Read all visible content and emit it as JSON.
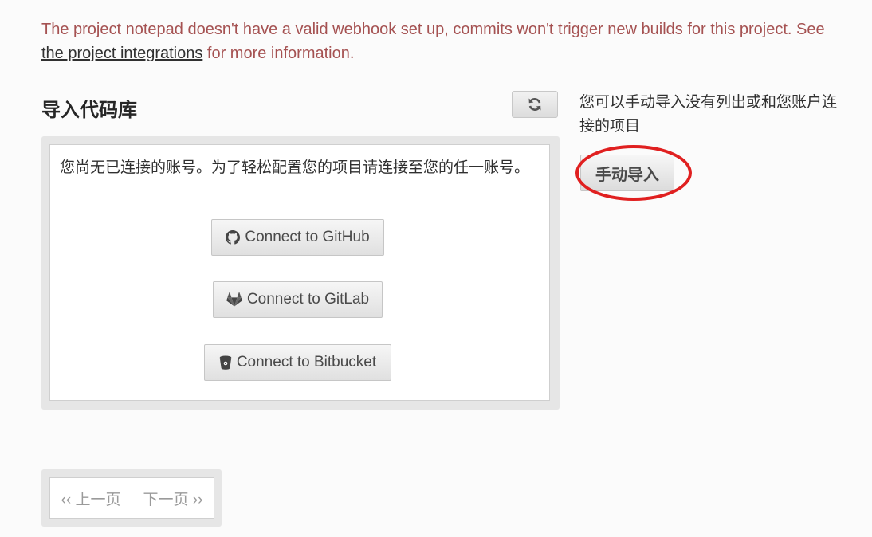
{
  "warning": {
    "text_before": "The project notepad doesn't have a valid webhook set up, commits won't trigger new builds for this project. See ",
    "link": "the project integrations",
    "text_after": " for more information."
  },
  "import": {
    "title": "导入代码库",
    "message": "您尚无已连接的账号。为了轻松配置您的项目请连接至您的任一账号。",
    "buttons": {
      "github": "Connect to GitHub",
      "gitlab": "Connect to GitLab",
      "bitbucket": "Connect to Bitbucket"
    }
  },
  "sidebar": {
    "text": "您可以手动导入没有列出或和您账户连接的项目",
    "manual_button": "手动导入"
  },
  "pagination": {
    "prev": "‹‹ 上一页",
    "next": "下一页 ››"
  },
  "colors": {
    "warning_text": "#a55252",
    "annotation_ring": "#e02020"
  },
  "icons": [
    "refresh-icon",
    "github-icon",
    "gitlab-icon",
    "bitbucket-icon"
  ]
}
